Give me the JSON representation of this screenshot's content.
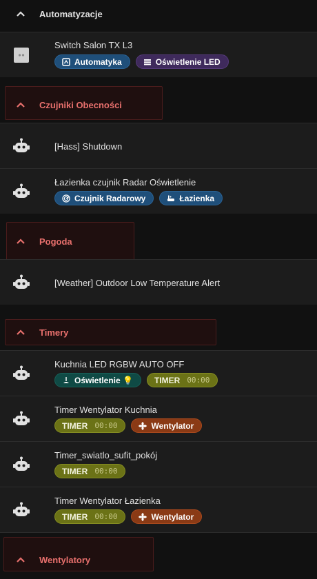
{
  "sections": {
    "automatyzacje": {
      "title": "Automatyzacje"
    },
    "czujniki": {
      "title": "Czujniki Obecności"
    },
    "pogoda": {
      "title": "Pogoda"
    },
    "timery": {
      "title": "Timery"
    },
    "wentylatory": {
      "title": "Wentylatory"
    }
  },
  "rows": {
    "switch_salon": {
      "name": "Switch Salon TX L3",
      "badges": [
        "Automatyka",
        "Oświetlenie LED"
      ]
    },
    "hass_shutdown": {
      "name": "[Hass] Shutdown"
    },
    "lazienka_radar": {
      "name": "Łazienka czujnik Radar Oświetlenie",
      "badges": [
        "Czujnik Radarowy",
        "Łazienka"
      ]
    },
    "weather_alert": {
      "name": "[Weather] Outdoor Low Temperature Alert"
    },
    "kuchnia_led": {
      "name": "Kuchnia LED RGBW AUTO OFF",
      "badges": [
        "Oświetlenie 💡",
        "TIMER"
      ],
      "timer_value": "00:00"
    },
    "timer_kuchnia": {
      "name": "Timer Wentylator Kuchnia",
      "badges": [
        "TIMER",
        "Wentylator"
      ],
      "timer_value": "00:00"
    },
    "timer_pokoj": {
      "name": "Timer_swiatlo_sufit_pokój",
      "badges": [
        "TIMER"
      ],
      "timer_value": "00:00"
    },
    "timer_lazienka": {
      "name": "Timer Wentylator Łazienka",
      "badges": [
        "TIMER",
        "Wentylator"
      ],
      "timer_value": "00:00"
    }
  },
  "colors": {
    "background": "#111111",
    "row_background": "#1c1c1c",
    "section_red": "#e8706d",
    "badge_blue": "#1f4f7a",
    "badge_purple": "#3f2a5c",
    "badge_teal": "#0f4a45",
    "badge_olive": "#6b7216",
    "badge_orange": "#8a3a15"
  },
  "icons": {
    "section_toggle": "chevron-up-icon",
    "automation": "robot-icon",
    "switch": "switch-icon",
    "automatyka_badge": "automation-tag-icon",
    "led_badge": "led-strip-icon",
    "radar_badge": "radar-icon",
    "bathroom_badge": "bathtub-icon",
    "lamp_badge": "lamp-icon",
    "fan_badge": "fan-icon"
  }
}
